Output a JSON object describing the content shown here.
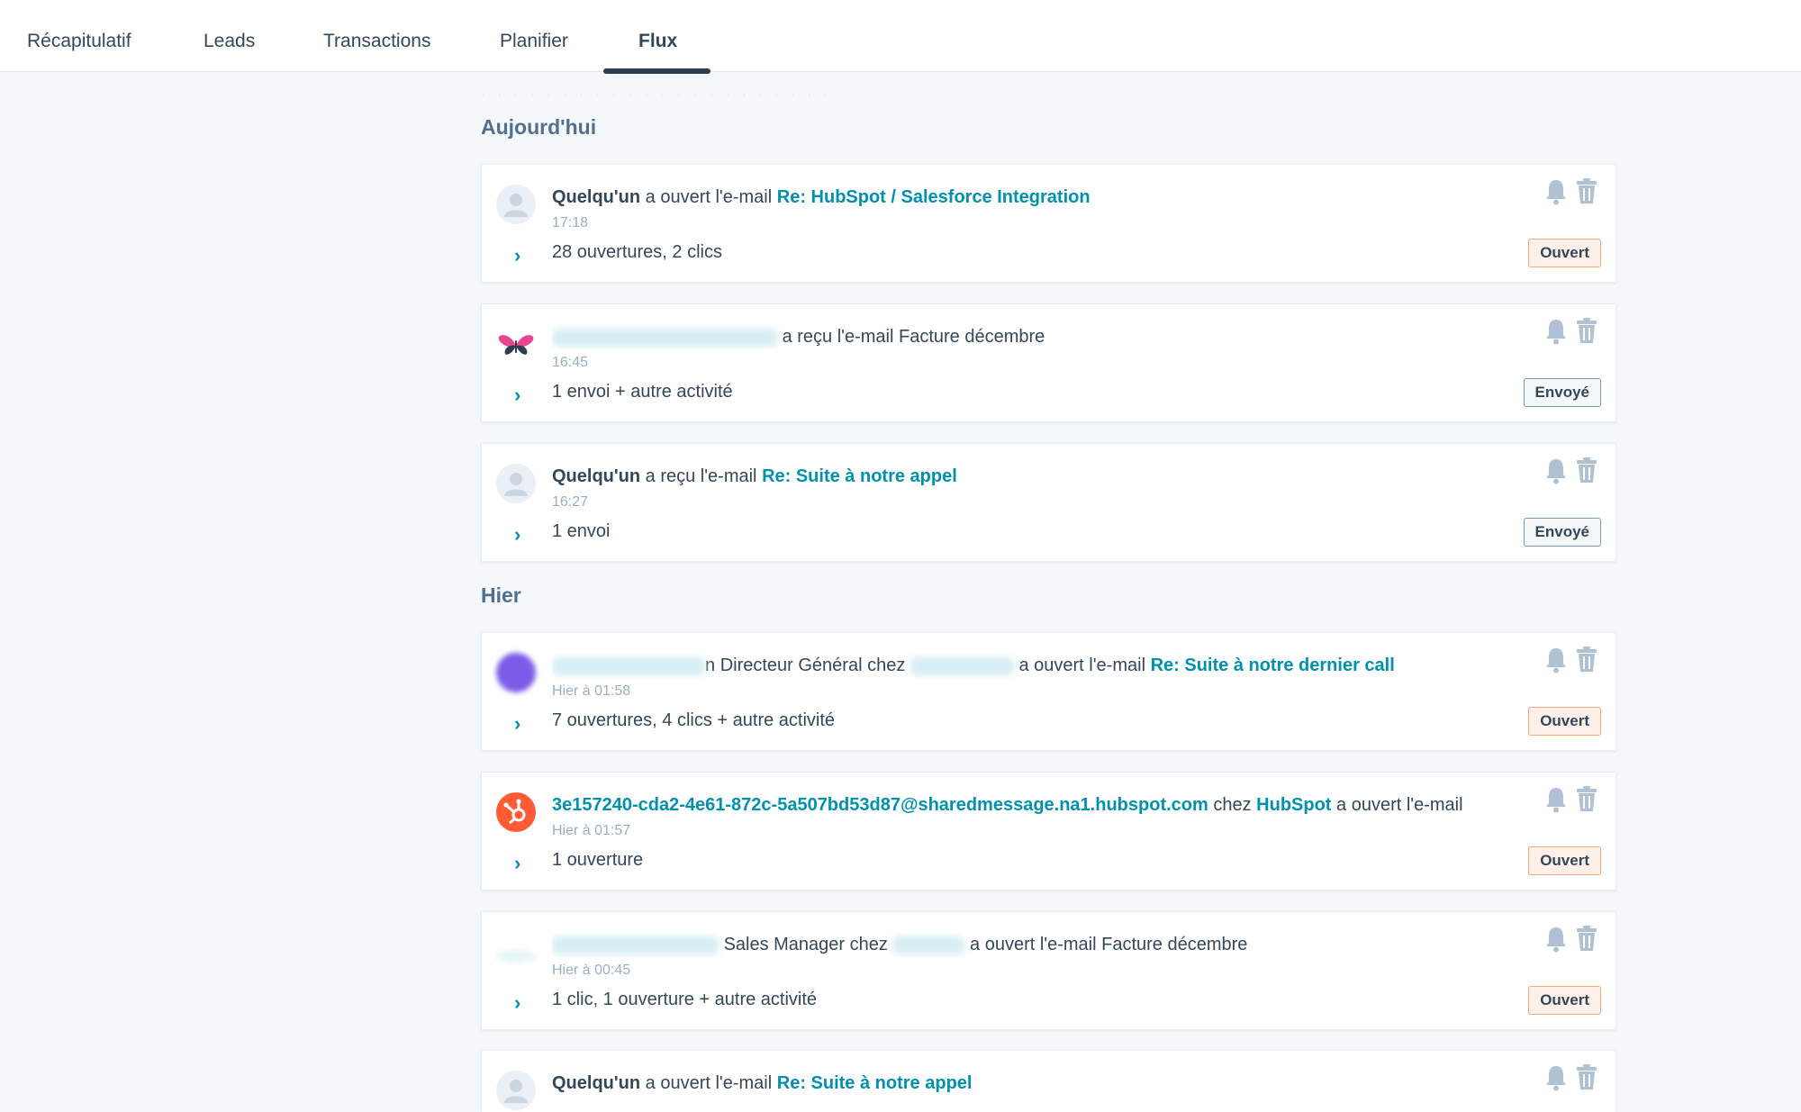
{
  "tabs": [
    {
      "label": "Récapitulatif"
    },
    {
      "label": "Leads"
    },
    {
      "label": "Transactions"
    },
    {
      "label": "Planifier"
    },
    {
      "label": "Flux"
    }
  ],
  "sections": {
    "today": "Aujourd'hui",
    "yesterday": "Hier"
  },
  "cards": [
    {
      "actor": "Quelqu'un",
      "action": "a ouvert l'e-mail",
      "subject": "Re: HubSpot / Salesforce Integration",
      "time": "17:18",
      "summary": "28 ouvertures, 2 clics",
      "status": "Ouvert"
    },
    {
      "action": "a reçu l'e-mail Facture décembre",
      "time": "16:45",
      "summary": "1 envoi + autre activité",
      "status": "Envoyé"
    },
    {
      "actor": "Quelqu'un",
      "action": "a reçu l'e-mail",
      "subject": "Re: Suite à notre appel",
      "time": "16:27",
      "summary": "1 envoi",
      "status": "Envoyé"
    },
    {
      "actor_tail": "n",
      "role": "Directeur Général chez",
      "action": "a ouvert l'e-mail",
      "subject": "Re: Suite à notre dernier call",
      "time": "Hier à 01:58",
      "summary": "7 ouvertures, 4 clics + autre activité",
      "status": "Ouvert"
    },
    {
      "actor": "3e157240-cda2-4e61-872c-5a507bd53d87@sharedmessage.na1.hubspot.com",
      "connector": "chez",
      "company": "HubSpot",
      "action": "a ouvert l'e-mail",
      "time": "Hier à 01:57",
      "summary": "1 ouverture",
      "status": "Ouvert"
    },
    {
      "role": "Sales Manager chez",
      "action": "a ouvert l'e-mail Facture décembre",
      "time": "Hier à 00:45",
      "summary": "1 clic, 1 ouverture + autre activité",
      "status": "Ouvert"
    },
    {
      "actor": "Quelqu'un",
      "action": "a ouvert l'e-mail",
      "subject": "Re: Suite à notre appel"
    }
  ],
  "colors": {
    "link": "#0091ae",
    "text": "#33475b",
    "muted": "#99afc4",
    "open_badge_bg": "#fef0e8",
    "open_badge_border": "#f5a97f",
    "sent_badge_border": "#7c98b6",
    "hubspot": "#ff5c35"
  },
  "icons": [
    "bell-icon",
    "trash-icon",
    "chevron-right-icon",
    "user-icon",
    "hubspot-sprocket-icon",
    "butterfly-logo-icon"
  ]
}
